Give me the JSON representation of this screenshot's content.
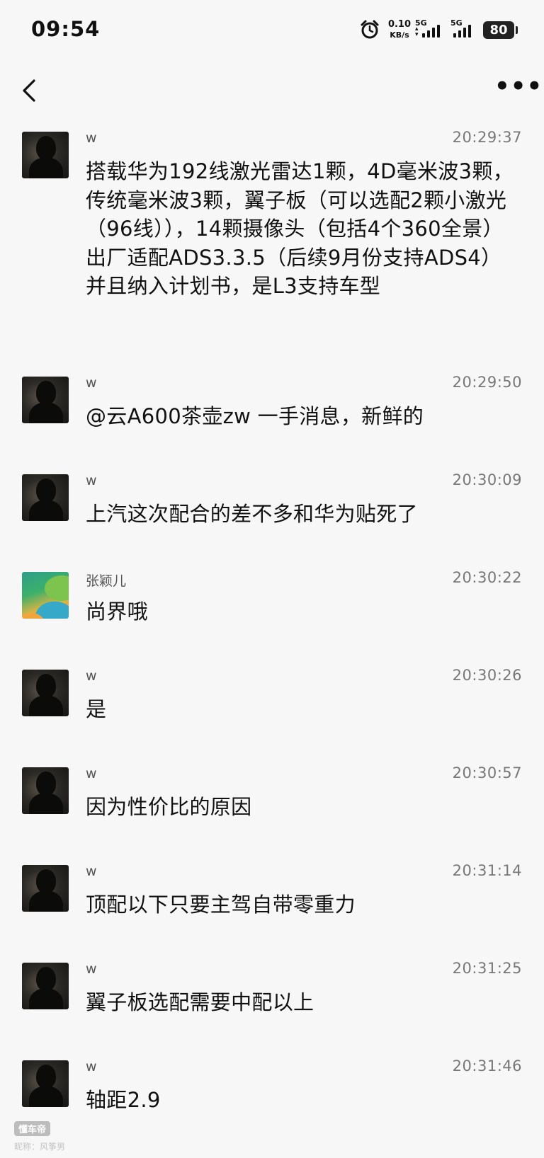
{
  "status_bar": {
    "time": "09:54",
    "net_speed_value": "0.10",
    "net_speed_unit": "KB/s",
    "sim1_label": "5G",
    "sim2_label": "5G",
    "battery": "80",
    "alarm_icon": "alarm-clock-icon"
  },
  "nav": {
    "back_icon": "chevron-left-icon",
    "more_icon": "more-dots-icon",
    "more_label": "•••"
  },
  "messages": [
    {
      "sender": "w",
      "time": "20:29:37",
      "text": "搭载华为192线激光雷达1颗，4D毫米波3颗，传统毫米波3颗，翼子板（可以选配2颗小激光（96线）），14颗摄像头（包括4个360全景）出厂适配ADS3.3.5（后续9月份支持ADS4）并且纳入计划书，是L3支持车型"
    },
    {
      "sender": "w",
      "time": "20:29:50",
      "text": "@云A600茶壶zw 一手消息，新鲜的"
    },
    {
      "sender": "w",
      "time": "20:30:09",
      "text": "上汽这次配合的差不多和华为贴死了"
    },
    {
      "sender": "张颖儿",
      "time": "20:30:22",
      "text": "尚界哦"
    },
    {
      "sender": "w",
      "time": "20:30:26",
      "text": "是"
    },
    {
      "sender": "w",
      "time": "20:30:57",
      "text": "因为性价比的原因"
    },
    {
      "sender": "w",
      "time": "20:31:14",
      "text": "顶配以下只要主驾自带零重力"
    },
    {
      "sender": "w",
      "time": "20:31:25",
      "text": "翼子板选配需要中配以上"
    },
    {
      "sender": "w",
      "time": "20:31:46",
      "text": "轴距2.9"
    }
  ],
  "watermark": {
    "logo": "懂车帝",
    "credit": "昵称：风筝男"
  }
}
